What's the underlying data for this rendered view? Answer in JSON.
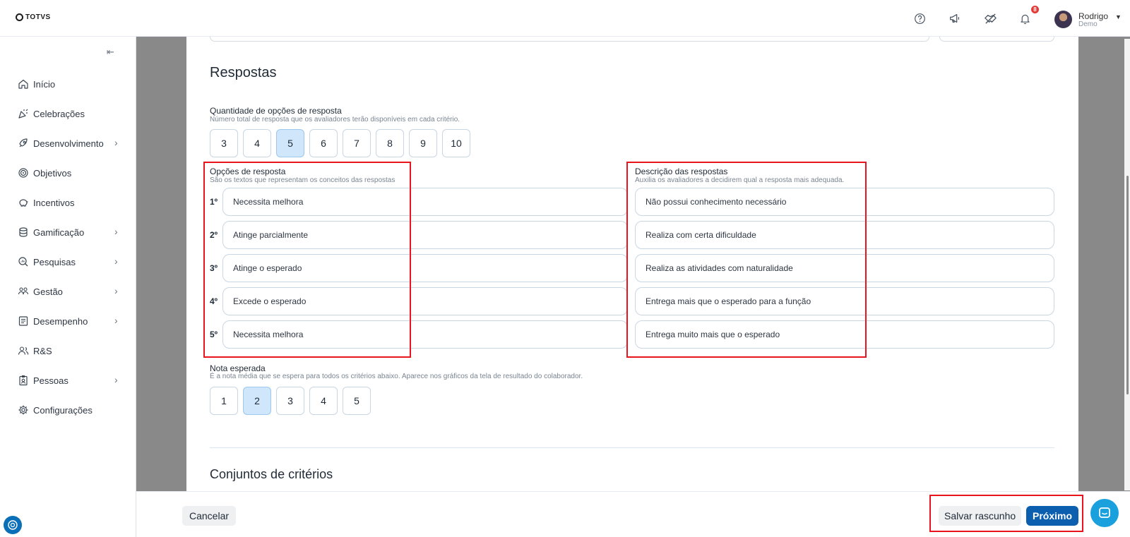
{
  "brand": {
    "logo_text": "TOTVS"
  },
  "topbar": {
    "notification_count": "8",
    "user_name": "Rodrigo",
    "user_org": "Demo",
    "icons": [
      "help-icon",
      "megaphone-icon",
      "handshake-icon",
      "bell-icon",
      "chevron-down-icon"
    ]
  },
  "sidebar": {
    "collapse_icon": "collapse-left-icon",
    "items": [
      {
        "label": "Início",
        "icon": "home-icon",
        "has_children": false
      },
      {
        "label": "Celebrações",
        "icon": "party-icon",
        "has_children": false
      },
      {
        "label": "Desenvolvimento",
        "icon": "rocket-icon",
        "has_children": true
      },
      {
        "label": "Objetivos",
        "icon": "target-icon",
        "has_children": false
      },
      {
        "label": "Incentivos",
        "icon": "piggy-bank-icon",
        "has_children": false
      },
      {
        "label": "Gamificação",
        "icon": "coins-icon",
        "has_children": true
      },
      {
        "label": "Pesquisas",
        "icon": "search-chart-icon",
        "has_children": true
      },
      {
        "label": "Gestão",
        "icon": "people-icon",
        "has_children": true
      },
      {
        "label": "Desempenho",
        "icon": "checklist-icon",
        "has_children": true
      },
      {
        "label": "R&S",
        "icon": "users-icon",
        "has_children": false
      },
      {
        "label": "Pessoas",
        "icon": "badge-icon",
        "has_children": true
      },
      {
        "label": "Configurações",
        "icon": "gear-icon",
        "has_children": false
      }
    ]
  },
  "respostas": {
    "title": "Respostas",
    "quantity": {
      "label": "Quantidade de opções de resposta",
      "hint": "Número total de resposta que os avaliadores terão disponíveis em cada critério.",
      "options": [
        "3",
        "4",
        "5",
        "6",
        "7",
        "8",
        "9",
        "10"
      ],
      "selected": "5"
    },
    "options_section": {
      "label": "Opções de resposta",
      "hint": "São os textos que representam os conceitos das respostas"
    },
    "descriptions_section": {
      "label": "Descrição das respostas",
      "hint": "Auxilia os avaliadores a decidirem qual a resposta mais adequada."
    },
    "rows": [
      {
        "ordinal": "1º",
        "option": "Necessita melhora",
        "description": "Não possui conhecimento necessário"
      },
      {
        "ordinal": "2º",
        "option": "Atinge parcialmente",
        "description": "Realiza com certa dificuldade"
      },
      {
        "ordinal": "3º",
        "option": "Atinge o esperado",
        "description": "Realiza as atividades com naturalidade"
      },
      {
        "ordinal": "4º",
        "option": "Excede o esperado",
        "description": "Entrega mais que o esperado para a função"
      },
      {
        "ordinal": "5º",
        "option": "Necessita melhora",
        "description": "Entrega muito mais que o esperado"
      }
    ],
    "expected_score": {
      "label": "Nota esperada",
      "hint": "É a nota média que se espera para todos os critérios abaixo. Aparece nos gráficos da tela de resultado do colaborador.",
      "options": [
        "1",
        "2",
        "3",
        "4",
        "5"
      ],
      "selected": "2"
    }
  },
  "criteria_sets": {
    "title": "Conjuntos de critérios"
  },
  "footer": {
    "cancel_label": "Cancelar",
    "save_draft_label": "Salvar rascunho",
    "next_label": "Próximo"
  },
  "colors": {
    "accent": "#0b5fae",
    "selected_bg": "#cfe6fb",
    "highlight_border": "#e8161c",
    "chat": "#1aa0dd"
  }
}
